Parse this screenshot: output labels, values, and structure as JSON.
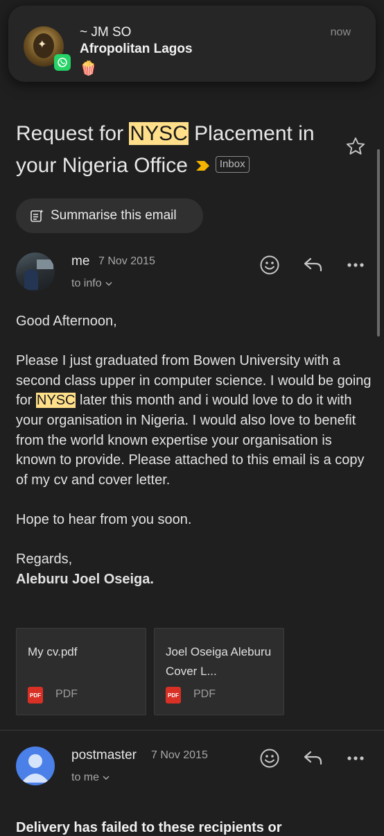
{
  "notification": {
    "title": "~ JM SO",
    "subtitle": "Afropolitan Lagos",
    "emoji": "🍿",
    "time": "now",
    "app_icon": "whatsapp-icon"
  },
  "email": {
    "subject_pre": "Request for ",
    "subject_hl": "NYSC",
    "subject_post": " Placement in your Nigeria Office",
    "label": "Inbox",
    "starred": false
  },
  "summarise": {
    "label": "Summarise this email"
  },
  "messages": [
    {
      "sender": "me",
      "date": "7 Nov 2015",
      "to": "to info",
      "greeting": "Good Afternoon,",
      "para_pre": "Please I just graduated from Bowen University with a second class upper in computer science. I would be going for ",
      "para_hl": "NYSC",
      "para_post": " later this month and i would love to do it with your organisation in Nigeria. I would also love to benefit from the world known expertise your organisation is known to provide.  Please attached to this email is a copy of my cv and cover letter.",
      "closing": "Hope to hear from you soon.",
      "regards": "Regards,",
      "signature": "Aleburu Joel Oseiga.",
      "attachments": [
        {
          "name": "My cv.pdf",
          "type": "PDF",
          "badge": "PDF"
        },
        {
          "name": "Joel Oseiga Aleburu Cover L...",
          "type": "PDF",
          "badge": "PDF"
        }
      ]
    },
    {
      "sender": "postmaster",
      "date": "7 Nov 2015",
      "to": "to me",
      "preview": "Delivery has failed to these recipients or"
    }
  ],
  "colors": {
    "background": "#1f1f1f",
    "highlight": "#ffdf8a",
    "important_marker": "#f4b400",
    "pdf_red": "#d93025",
    "whatsapp_green": "#25d366"
  }
}
